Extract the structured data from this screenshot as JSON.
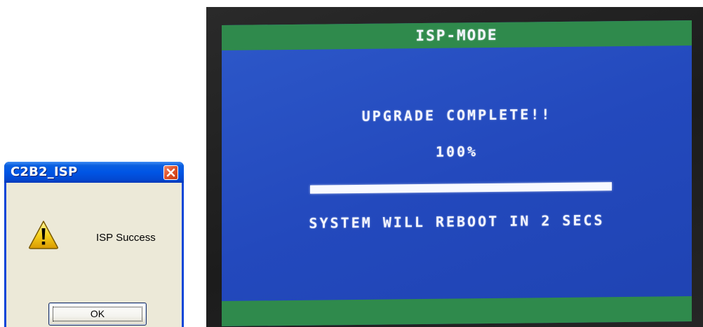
{
  "dialog": {
    "title": "C2B2_ISP",
    "message": "ISP Success",
    "ok_label": "OK",
    "icon": "warning-icon",
    "close_icon": "close-icon"
  },
  "osd": {
    "title": "ISP-MODE",
    "status": "UPGRADE COMPLETE!!",
    "percent_text": "100%",
    "progress": 1.0,
    "reboot_message": "SYSTEM WILL REBOOT IN 2 SECS"
  },
  "colors": {
    "xp_title_blue": "#0055e5",
    "xp_body": "#ece9d8",
    "osd_blue": "#2349bd",
    "osd_green": "#2f8a4c",
    "osd_text": "#f4f6ff"
  }
}
